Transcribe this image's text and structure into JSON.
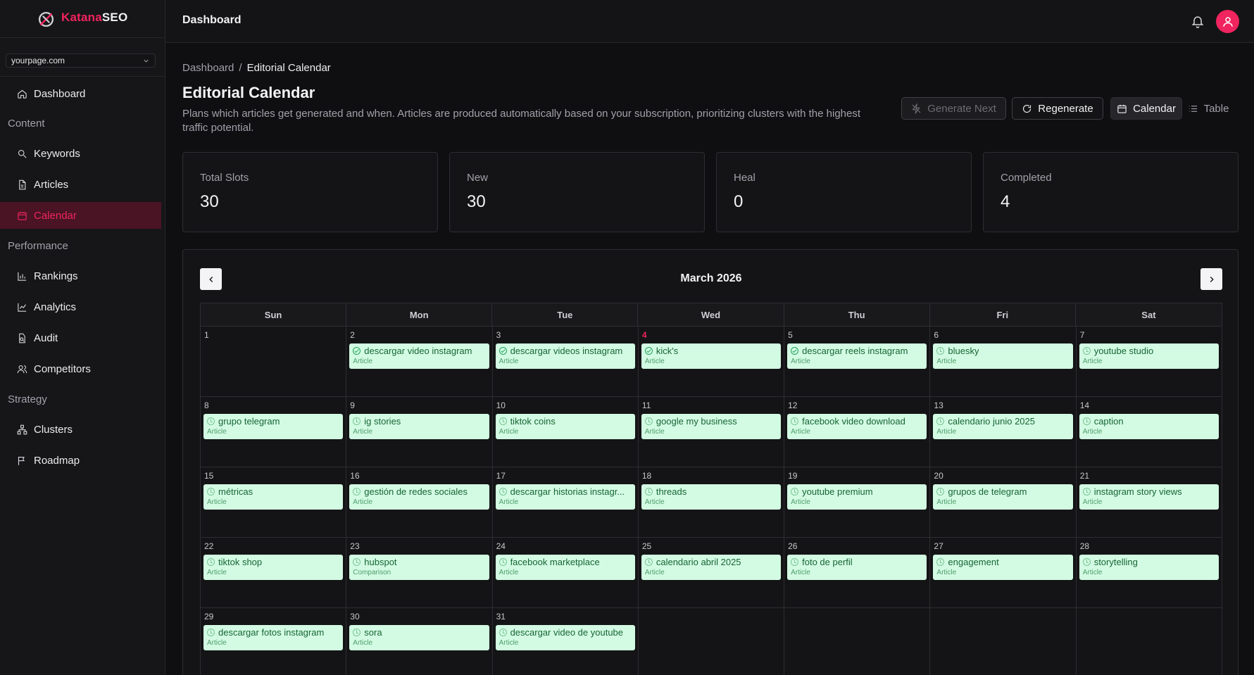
{
  "brand": {
    "part1": "Katana",
    "part2": "SEO"
  },
  "site_selector": {
    "value": "yourpage.com"
  },
  "sidebar": {
    "dashboard": "Dashboard",
    "groups": {
      "content": "Content",
      "performance": "Performance",
      "strategy": "Strategy"
    },
    "items": {
      "keywords": "Keywords",
      "articles": "Articles",
      "calendar": "Calendar",
      "rankings": "Rankings",
      "analytics": "Analytics",
      "audit": "Audit",
      "competitors": "Competitors",
      "clusters": "Clusters",
      "roadmap": "Roadmap"
    }
  },
  "topbar": {
    "title": "Dashboard"
  },
  "breadcrumb": {
    "root": "Dashboard",
    "separator": "/",
    "current": "Editorial Calendar"
  },
  "page": {
    "title": "Editorial Calendar",
    "description": "Plans which articles get generated and when. Articles are produced automatically based on your subscription, prioritizing clusters with the highest traffic potential."
  },
  "actions": {
    "generate_next": "Generate Next",
    "regenerate": "Regenerate",
    "calendar": "Calendar",
    "table": "Table"
  },
  "stats": [
    {
      "label": "Total Slots",
      "value": "30"
    },
    {
      "label": "New",
      "value": "30"
    },
    {
      "label": "Heal",
      "value": "0"
    },
    {
      "label": "Completed",
      "value": "4"
    }
  ],
  "calendar": {
    "month": "March 2026",
    "today": 4,
    "weekdays": [
      "Sun",
      "Mon",
      "Tue",
      "Wed",
      "Thu",
      "Fri",
      "Sat"
    ],
    "weeks": [
      [
        {
          "day": "1"
        },
        {
          "day": "2",
          "title": "descargar video instagram",
          "type": "Article",
          "status": "done"
        },
        {
          "day": "3",
          "title": "descargar videos instagram",
          "type": "Article",
          "status": "done"
        },
        {
          "day": "4",
          "title": "kick's",
          "type": "Article",
          "status": "done"
        },
        {
          "day": "5",
          "title": "descargar reels instagram",
          "type": "Article",
          "status": "done"
        },
        {
          "day": "6",
          "title": "bluesky",
          "type": "Article",
          "status": "pending"
        },
        {
          "day": "7",
          "title": "youtube studio",
          "type": "Article",
          "status": "pending"
        }
      ],
      [
        {
          "day": "8",
          "title": "grupo telegram",
          "type": "Article",
          "status": "pending"
        },
        {
          "day": "9",
          "title": "ig stories",
          "type": "Article",
          "status": "pending"
        },
        {
          "day": "10",
          "title": "tiktok coins",
          "type": "Article",
          "status": "pending"
        },
        {
          "day": "11",
          "title": "google my business",
          "type": "Article",
          "status": "pending"
        },
        {
          "day": "12",
          "title": "facebook video download",
          "type": "Article",
          "status": "pending"
        },
        {
          "day": "13",
          "title": "calendario junio 2025",
          "type": "Article",
          "status": "pending"
        },
        {
          "day": "14",
          "title": "caption",
          "type": "Article",
          "status": "pending"
        }
      ],
      [
        {
          "day": "15",
          "title": "métricas",
          "type": "Article",
          "status": "pending"
        },
        {
          "day": "16",
          "title": "gestión de redes sociales",
          "type": "Article",
          "status": "pending"
        },
        {
          "day": "17",
          "title": "descargar historias instagr...",
          "type": "Article",
          "status": "pending"
        },
        {
          "day": "18",
          "title": "threads",
          "type": "Article",
          "status": "pending"
        },
        {
          "day": "19",
          "title": "youtube premium",
          "type": "Article",
          "status": "pending"
        },
        {
          "day": "20",
          "title": "grupos de telegram",
          "type": "Article",
          "status": "pending"
        },
        {
          "day": "21",
          "title": "instagram story views",
          "type": "Article",
          "status": "pending"
        }
      ],
      [
        {
          "day": "22",
          "title": "tiktok shop",
          "type": "Article",
          "status": "pending"
        },
        {
          "day": "23",
          "title": "hubspot",
          "type": "Comparison",
          "status": "pending"
        },
        {
          "day": "24",
          "title": "facebook marketplace",
          "type": "Article",
          "status": "pending"
        },
        {
          "day": "25",
          "title": "calendario abril 2025",
          "type": "Article",
          "status": "pending"
        },
        {
          "day": "26",
          "title": "foto de perfil",
          "type": "Article",
          "status": "pending"
        },
        {
          "day": "27",
          "title": "engagement",
          "type": "Article",
          "status": "pending"
        },
        {
          "day": "28",
          "title": "storytelling",
          "type": "Article",
          "status": "pending"
        }
      ],
      [
        {
          "day": "29",
          "title": "descargar fotos instagram",
          "type": "Article",
          "status": "pending"
        },
        {
          "day": "30",
          "title": "sora",
          "type": "Article",
          "status": "pending"
        },
        {
          "day": "31",
          "title": "descargar video de youtube",
          "type": "Article",
          "status": "pending"
        },
        {
          "day": ""
        },
        {
          "day": ""
        },
        {
          "day": ""
        },
        {
          "day": ""
        }
      ]
    ]
  }
}
